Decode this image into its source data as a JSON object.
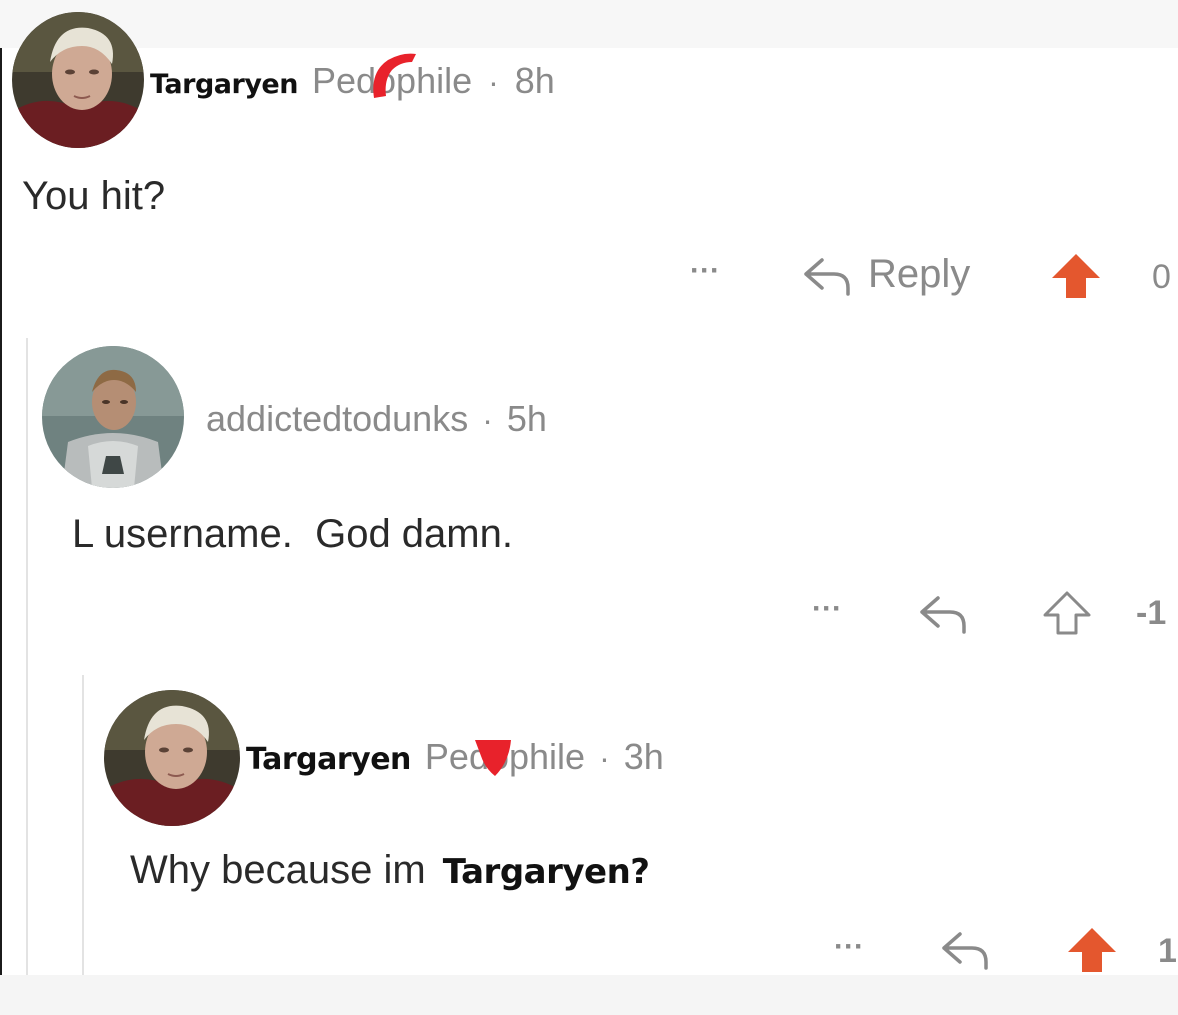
{
  "comments": [
    {
      "username": "Targaryen",
      "flair": "Pedophile",
      "separator": "·",
      "time": "8h",
      "body": "You hit?",
      "more": "···",
      "reply_label": "Reply",
      "score": "0",
      "upvoted": true
    },
    {
      "username": "addictedtodunks",
      "separator": "·",
      "time": "5h",
      "body": "L username.  God damn.",
      "more": "···",
      "score": "-1",
      "upvoted": false
    },
    {
      "username": "Targaryen",
      "flair": "Pedophile",
      "separator": "·",
      "time": "3h",
      "body_prefix": "Why because im",
      "body_bold": "Targaryen?",
      "more": "···",
      "score": "1",
      "upvoted": true
    }
  ],
  "colors": {
    "upvote": "#e4572e",
    "text": "#2a2a2a",
    "muted": "#8a8a8a",
    "censor_mark": "#e8222b"
  },
  "icons": {
    "reply": "reply-arrow-icon",
    "upvote": "upvote-arrow-icon",
    "more": "more-options-icon"
  }
}
